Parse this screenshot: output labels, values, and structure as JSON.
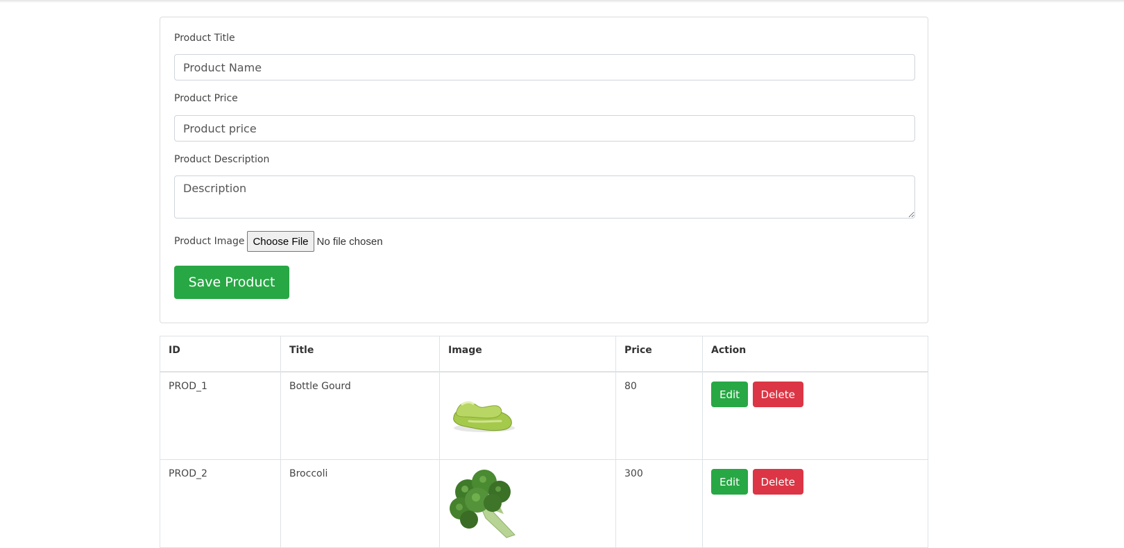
{
  "form": {
    "title_label": "Product Title",
    "title_placeholder": "Product Name",
    "price_label": "Product Price",
    "price_placeholder": "Product price",
    "description_label": "Product Description",
    "description_placeholder": "Description",
    "image_label": "Product Image",
    "file_button": "Choose File",
    "file_status": "No file chosen",
    "save_label": "Save Product"
  },
  "table": {
    "headers": [
      "ID",
      "Title",
      "Image",
      "Price",
      "Action"
    ],
    "rows": [
      {
        "id": "PROD_1",
        "title": "Bottle Gourd",
        "image": "bottle-gourd-image",
        "price": "80",
        "edit": "Edit",
        "delete": "Delete"
      },
      {
        "id": "PROD_2",
        "title": "Broccoli",
        "image": "broccoli-image",
        "price": "300",
        "edit": "Edit",
        "delete": "Delete"
      }
    ]
  },
  "colors": {
    "success": "#28a745",
    "danger": "#dc3545",
    "border": "#dee2e6"
  }
}
